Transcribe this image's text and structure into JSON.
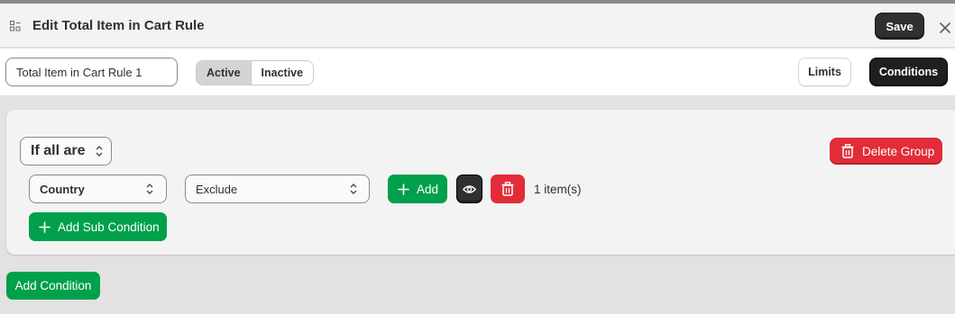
{
  "header": {
    "title": "Edit Total Item in Cart Rule",
    "save_label": "Save"
  },
  "toolbar": {
    "rule_name_value": "Total Item in Cart Rule 1",
    "status_options": [
      "Active",
      "Inactive"
    ],
    "status_selected": "Active",
    "limits_label": "Limits",
    "conditions_label": "Conditions"
  },
  "group": {
    "match_label": "If all are",
    "delete_group_label": "Delete Group",
    "condition": {
      "field": "Country",
      "operator": "Exclude",
      "add_label": "Add",
      "item_count": "1 item(s)"
    },
    "add_sub_condition_label": "Add Sub Condition"
  },
  "add_condition_label": "Add Condition",
  "colors": {
    "primary_dark": "#303030",
    "success_green": "#00a04c",
    "critical_red": "#e22c38",
    "page_bg": "#e3e1e1"
  }
}
